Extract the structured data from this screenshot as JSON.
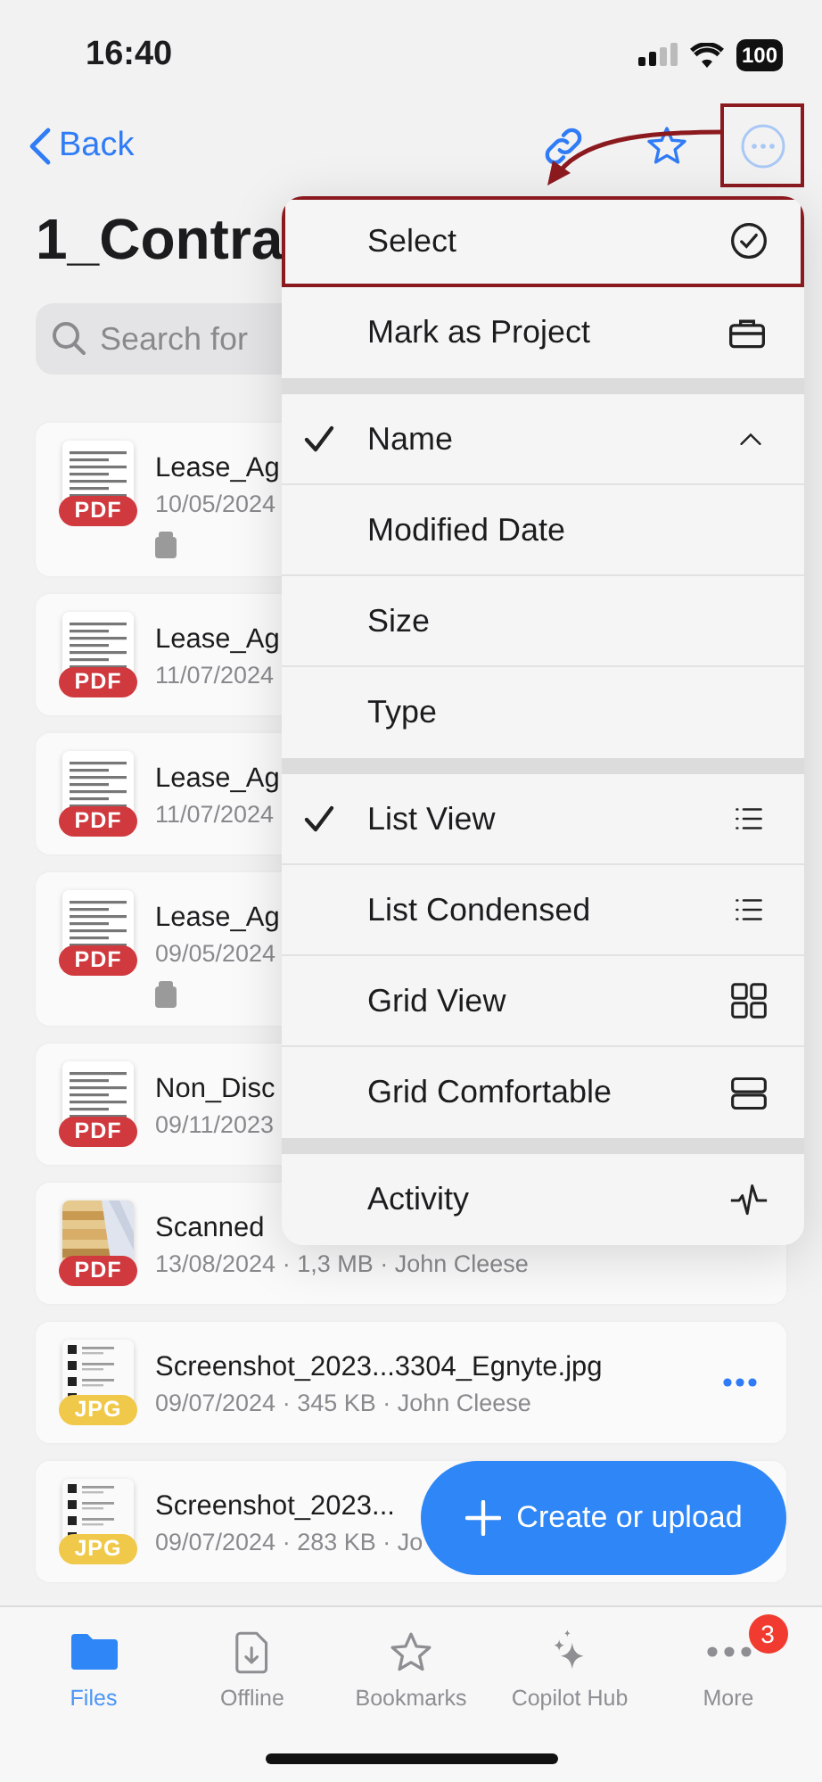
{
  "status_bar": {
    "time": "16:40",
    "battery": "100"
  },
  "nav": {
    "back": "Back",
    "more_highlighted": true
  },
  "title": "1_Contra",
  "search": {
    "placeholder": "Search for"
  },
  "files": [
    {
      "name": "Lease_Ag",
      "meta": "10/05/2024",
      "badge": "PDF",
      "color": "#d0393e",
      "kind": "document",
      "locked": true
    },
    {
      "name": "Lease_Ag",
      "meta": "11/07/2024",
      "badge": "PDF",
      "color": "#d0393e",
      "kind": "document",
      "locked": false
    },
    {
      "name": "Lease_Ag",
      "meta": "11/07/2024",
      "badge": "PDF",
      "color": "#d0393e",
      "kind": "document",
      "locked": false
    },
    {
      "name": "Lease_Ag",
      "meta": "09/05/2024",
      "badge": "PDF",
      "color": "#d0393e",
      "kind": "document",
      "locked": true
    },
    {
      "name": "Non_Disc",
      "meta": "09/11/2023",
      "badge": "PDF",
      "color": "#d0393e",
      "kind": "document",
      "locked": false
    },
    {
      "name": "Scanned",
      "meta": "13/08/2024 · 1,3 MB · John Cleese",
      "badge": "PDF",
      "color": "#d0393e",
      "locked": false
    },
    {
      "name": "Screenshot_2023...3304_Egnyte.jpg",
      "meta": "09/07/2024 · 345 KB · John Cleese",
      "badge": "JPG",
      "color": "#f0c94a",
      "kind": "screenshot",
      "locked": false,
      "actions_visible": true
    },
    {
      "name": "Screenshot_2023...",
      "meta": "09/07/2024 · 283 KB · Jo",
      "badge": "JPG",
      "color": "#f0c94a",
      "kind": "screenshot",
      "locked": false
    }
  ],
  "fab": {
    "label": "Create or upload"
  },
  "menu": {
    "groups": [
      {
        "items": [
          {
            "label": "Select",
            "checked": false,
            "highlighted": true
          },
          {
            "label": "Mark as Project",
            "checked": false,
            "highlighted": false
          }
        ]
      },
      {
        "items": [
          {
            "label": "Name",
            "checked": true,
            "highlighted": false
          },
          {
            "label": "Modified Date",
            "checked": false,
            "highlighted": false
          },
          {
            "label": "Size",
            "checked": false,
            "highlighted": false
          },
          {
            "label": "Type",
            "checked": false,
            "highlighted": false
          }
        ]
      },
      {
        "items": [
          {
            "label": "List View",
            "checked": true,
            "highlighted": false
          },
          {
            "label": "List Condensed",
            "checked": false,
            "highlighted": false
          },
          {
            "label": "Grid View",
            "checked": false,
            "highlighted": false
          },
          {
            "label": "Grid Comfortable",
            "checked": false,
            "highlighted": false
          }
        ]
      },
      {
        "items": [
          {
            "label": "Activity",
            "checked": false,
            "highlighted": false
          }
        ]
      }
    ]
  },
  "tab_bar": [
    {
      "label": "Files",
      "selected": true
    },
    {
      "label": "Offline",
      "selected": false
    },
    {
      "label": "Bookmarks",
      "selected": false
    },
    {
      "label": "Copilot Hub",
      "selected": false
    },
    {
      "label": "More",
      "selected": false,
      "badge": "3"
    }
  ]
}
